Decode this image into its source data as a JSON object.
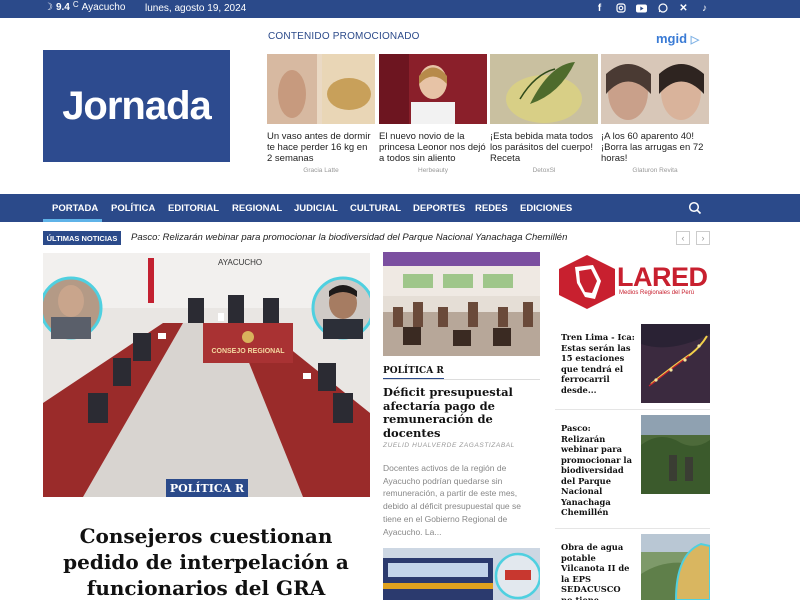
{
  "topbar": {
    "temperature": "9.4",
    "temp_unit": "C",
    "city": "Ayacucho",
    "date": "lunes, agosto 19, 2024",
    "social_icons": [
      "facebook-icon",
      "instagram-icon",
      "youtube-icon",
      "whatsapp-icon",
      "x-icon",
      "tiktok-icon"
    ]
  },
  "logo": {
    "text": "Jornada"
  },
  "promo": {
    "heading": "CONTENIDO PROMOCIONADO",
    "brand": "mgid",
    "items": [
      {
        "text": "Un vaso antes de dormir te hace perder 16 kg en 2 semanas",
        "source": "Gracia Latte"
      },
      {
        "text": "El nuevo novio de la princesa Leonor nos dejó a todos sin aliento",
        "source": "Herbeauty"
      },
      {
        "text": "¡Esta bebida mata todos los parásitos del cuerpo! Receta",
        "source": "DetoxSl"
      },
      {
        "text": "¡A los 60 aparento 40! ¡Borra las arrugas en 72 horas!",
        "source": "Glaturon Revita"
      }
    ]
  },
  "nav": {
    "items": [
      "PORTADA",
      "POLÍTICA",
      "EDITORIAL",
      "REGIONAL",
      "JUDICIAL",
      "CULTURAL",
      "DEPORTES",
      "REDES",
      "EDICIONES"
    ],
    "active": "PORTADA"
  },
  "ticker": {
    "label": "ÚLTIMAS NOTICIAS",
    "text": "Pasco: Relizarán webinar para promocionar la biodiversidad del Parque Nacional Yanachaga Chemillén",
    "prev": "‹",
    "next": "›"
  },
  "main_story": {
    "image_sign": "AYACUCHO",
    "image_label": "CONSEJO REGIONAL",
    "category": "POLÍTICA R",
    "title": "Consejeros cuestionan pedido de interpelación a funcionarios del GRA"
  },
  "mid_story": {
    "category": "POLÍTICA R",
    "title": "Déficit presupuestal afectaría pago de remuneración de docentes",
    "author": "ZUELID HUALVERDE ZAGASTIZABAL",
    "excerpt": "Docentes activos de la región de Ayacucho podrían quedarse sin remuneración, a partir de este mes, debido al déficit presupuestal que se tiene en el Gobierno Regional de Ayacucho. La..."
  },
  "sidebar": {
    "brand_main": "LARED",
    "brand_sub": "Medios Regionales del Perú",
    "items": [
      {
        "title": "Tren Lima - Ica: Estas serán las 15 estaciones que tendrá el ferrocarril desde..."
      },
      {
        "title": "Pasco: Relizarán webinar para promocionar la biodiversidad del Parque Nacional Yanachaga Chemillén"
      },
      {
        "title": "Obra de agua potable Vilcanota II de la EPS SEDACUSCO no tiene licencia"
      }
    ]
  },
  "colors": {
    "brand_blue": "#2b4a8a",
    "accent_light_blue": "#5fb3e8",
    "lared_red": "#c8202f"
  }
}
